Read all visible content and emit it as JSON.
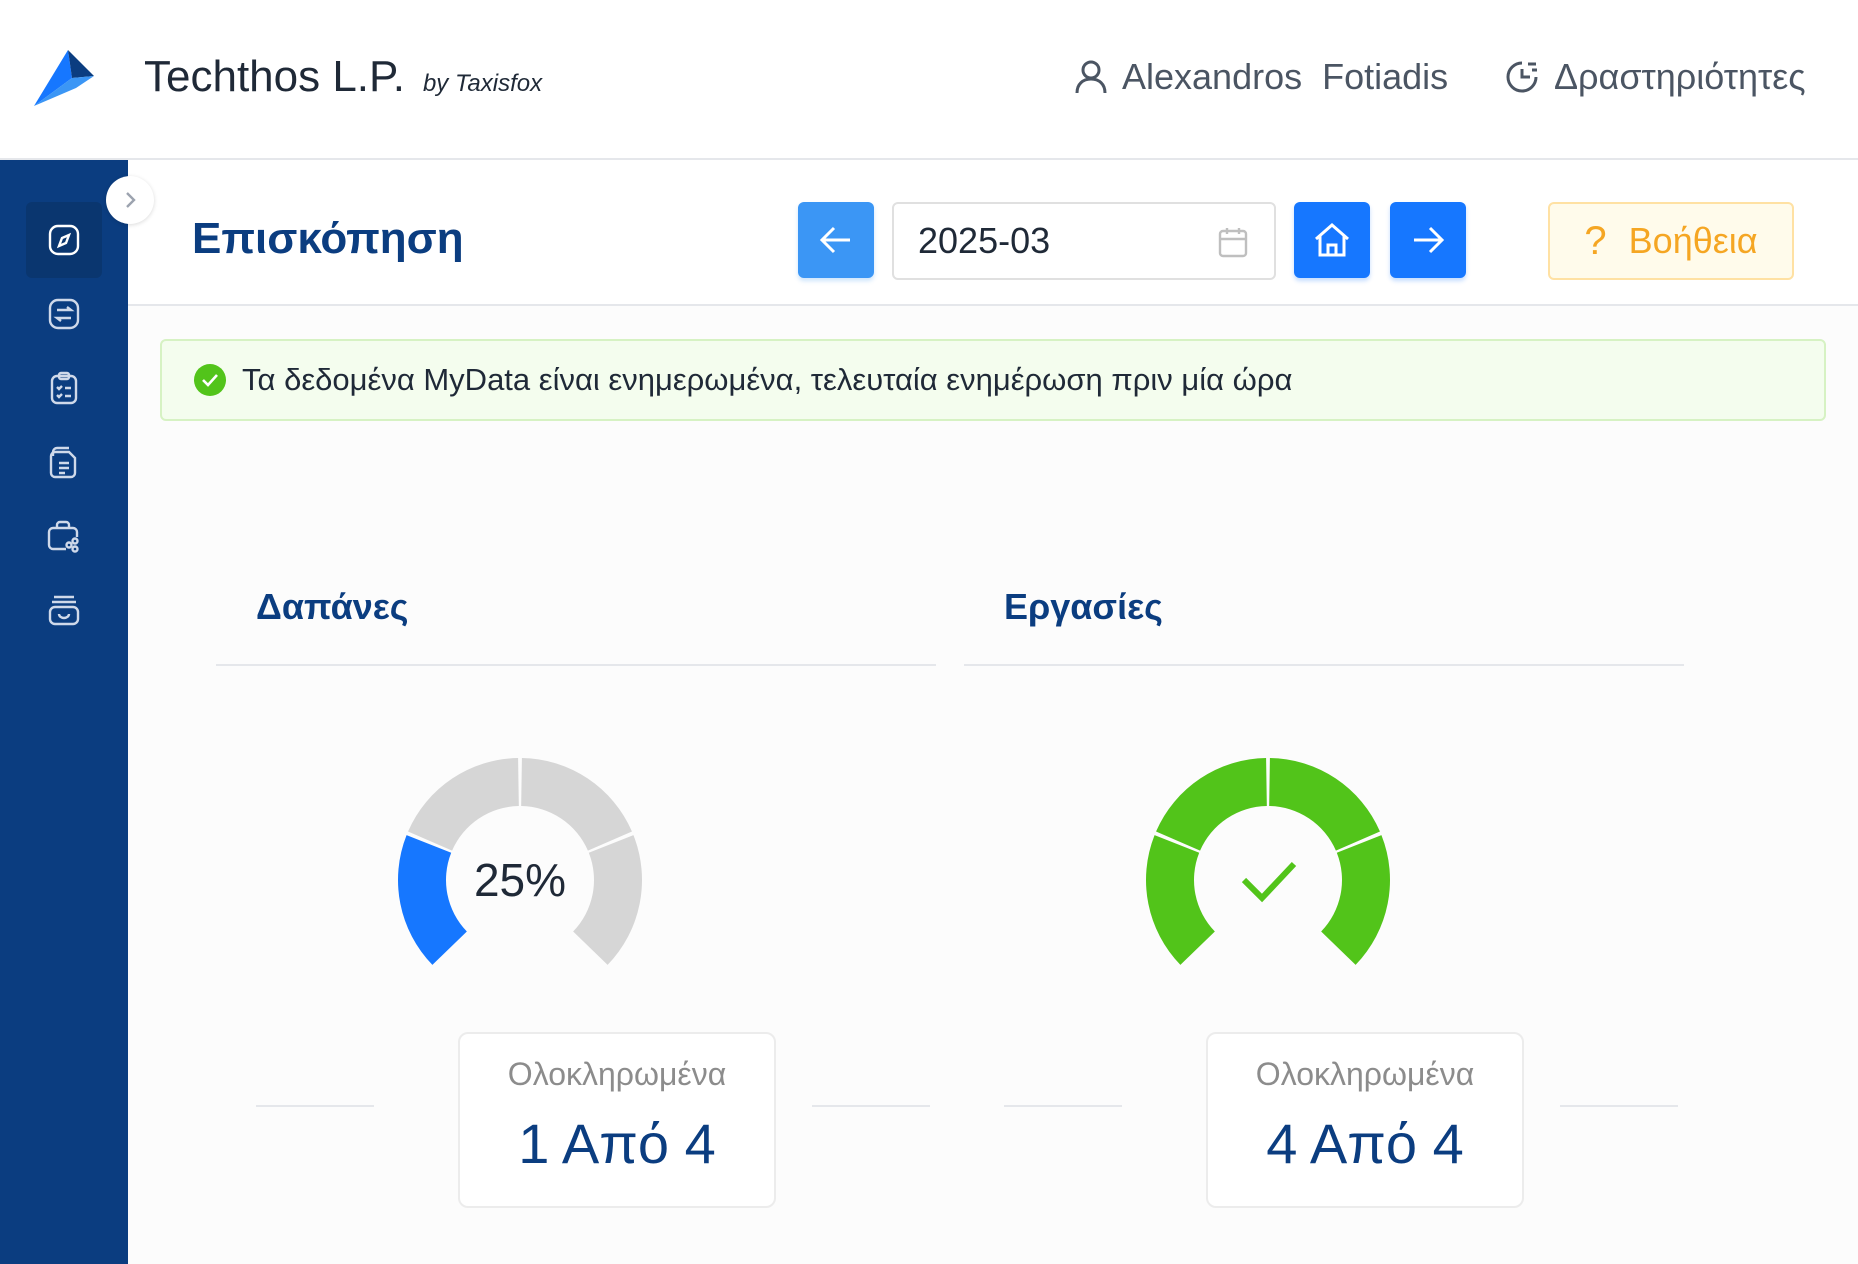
{
  "header": {
    "company": "Techthos L.P.",
    "by": "by Taxisfox",
    "user_name": "Alexandros  Fotiadis",
    "activities": "Δραστηριότητες"
  },
  "sidebar": {
    "items": [
      {
        "icon": "compass-icon",
        "active": true
      },
      {
        "icon": "transactions-icon",
        "active": false
      },
      {
        "icon": "clipboard-checklist-icon",
        "active": false
      },
      {
        "icon": "documents-icon",
        "active": false
      },
      {
        "icon": "briefcase-share-icon",
        "active": false
      },
      {
        "icon": "archive-box-icon",
        "active": false
      }
    ]
  },
  "toolbar": {
    "title": "Επισκόπηση",
    "period": "2025-03",
    "help": "Βοήθεια"
  },
  "alert": {
    "message": "Τα δεδομένα MyData είναι ενημερωμένα, τελευταία ενημέρωση πριν μία ώρα"
  },
  "cards": [
    {
      "title": "Δαπάνες",
      "completed_fraction": 0.25,
      "center_text": "25%",
      "status_label": "Ολοκληρωμένα",
      "status_value": "1 Από 4",
      "color": "#1677ff"
    },
    {
      "title": "Εργασίες",
      "completed_fraction": 1.0,
      "center_icon": "check-icon",
      "status_label": "Ολοκληρωμένα",
      "status_value": "4 Από 4",
      "color": "#52c41a"
    }
  ],
  "colors": {
    "sidebar": "#0b3d80",
    "primary": "#1677ff",
    "success": "#52c41a",
    "warning": "#f5a623",
    "gauge_track": "#d6d6d6"
  }
}
